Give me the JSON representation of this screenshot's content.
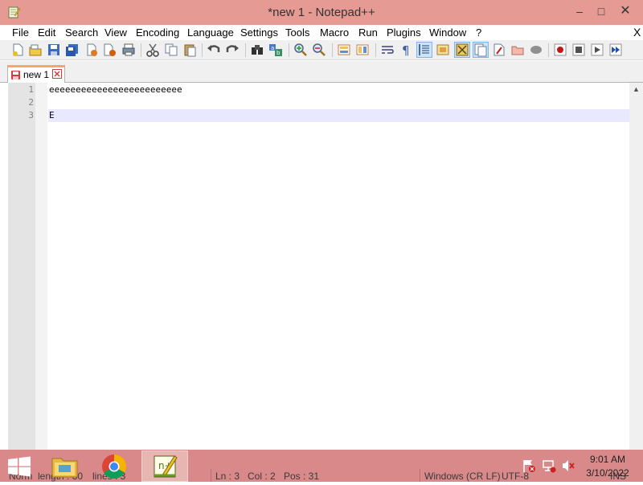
{
  "window": {
    "title": "*new 1 - Notepad++",
    "min_glyph": "–",
    "max_glyph": "□",
    "close_glyph": "✕"
  },
  "menu": {
    "items": [
      "File",
      "Edit",
      "Search",
      "View",
      "Encoding",
      "Language",
      "Settings",
      "Tools",
      "Macro",
      "Run",
      "Plugins",
      "Window",
      "?"
    ],
    "close_label": "X"
  },
  "toolbar": {
    "icons": [
      "new-file-icon",
      "open-file-icon",
      "save-icon",
      "save-all-icon",
      "close-icon",
      "close-all-icon",
      "print-icon",
      "cut-icon",
      "copy-icon",
      "paste-icon",
      "undo-icon",
      "redo-icon",
      "find-icon",
      "replace-icon",
      "zoom-in-icon",
      "zoom-out-icon",
      "sync-vertical-icon",
      "sync-horizontal-icon",
      "word-wrap-icon",
      "show-all-chars-icon",
      "indent-guide-icon",
      "user-language-icon",
      "doc-map-icon",
      "function-list-icon",
      "folder-workspace-icon",
      "monitoring-icon",
      "record-macro-icon",
      "stop-record-icon",
      "play-macro-icon",
      "run-macro-multiple-icon"
    ]
  },
  "tabs": [
    {
      "label": "new 1",
      "icon": "unsaved-file-icon",
      "close_icon": "tab-close-icon"
    }
  ],
  "editor": {
    "lines": [
      {
        "number": "1",
        "text": "eeeeeeeeeeeeeeeeeeeeeeeee"
      },
      {
        "number": "2",
        "text": ""
      },
      {
        "number": "3",
        "text": "E"
      }
    ],
    "current_line": 3,
    "scroll_up_glyph": "▲"
  },
  "statusbar": {
    "doc_type": "Norm",
    "length": "length : 30",
    "lines": "lines : 3",
    "ln": "Ln : 3",
    "col": "Col : 2",
    "pos": "Pos : 31",
    "eol": "Windows (CR LF)",
    "encoding": "UTF-8",
    "mode": "INS"
  },
  "taskbar": {
    "apps": [
      {
        "name": "file-explorer",
        "icon": "folder-icon"
      },
      {
        "name": "chrome",
        "icon": "chrome-icon"
      },
      {
        "name": "notepad-plus-plus",
        "icon": "notepad-plus-plus-icon",
        "active": true
      }
    ],
    "tray_icons": [
      "action-center-flag-icon",
      "network-icon",
      "volume-muted-icon"
    ],
    "clock": {
      "time": "9:01 AM",
      "date": "3/10/2022"
    }
  },
  "colors": {
    "titlebar": "#e59b93",
    "taskbar": "#d9898a",
    "current_line": "#e8e8ff",
    "gutter": "#e4e4e4"
  }
}
